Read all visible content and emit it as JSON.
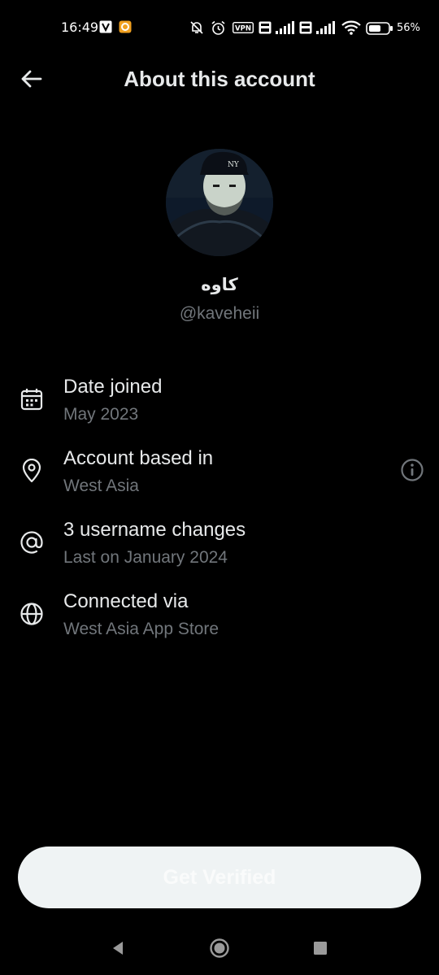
{
  "status_bar": {
    "time": "16:49",
    "battery_percent": "56%",
    "icons": [
      "notification-v-icon",
      "notification-app-icon",
      "mute-bell-icon",
      "alarm-icon",
      "vpn-icon",
      "volte-icon",
      "signal-icon",
      "volte-icon",
      "signal-icon",
      "wifi-icon",
      "battery-icon"
    ],
    "vpn_label": "VPN"
  },
  "header": {
    "title": "About this account",
    "back_icon": "arrow-left-icon"
  },
  "profile": {
    "display_name": "کاوه",
    "handle": "@kaveheii"
  },
  "info": [
    {
      "icon": "calendar-icon",
      "title": "Date joined",
      "subtitle": "May 2023"
    },
    {
      "icon": "location-pin-icon",
      "title": "Account based in",
      "subtitle": "West Asia",
      "extra_icon": "info-icon"
    },
    {
      "icon": "at-icon",
      "title": "3 username changes",
      "subtitle": "Last on January 2024"
    },
    {
      "icon": "globe-icon",
      "title": "Connected via",
      "subtitle": "West Asia App Store"
    }
  ],
  "cta": {
    "label": "Get Verified"
  },
  "nav": {
    "icons": [
      "back-triangle-icon",
      "home-circle-icon",
      "recents-square-icon"
    ]
  },
  "colors": {
    "background": "#000000",
    "primary_text": "#e7e9ea",
    "secondary_text": "#71767b",
    "button_bg": "#eff3f4"
  }
}
